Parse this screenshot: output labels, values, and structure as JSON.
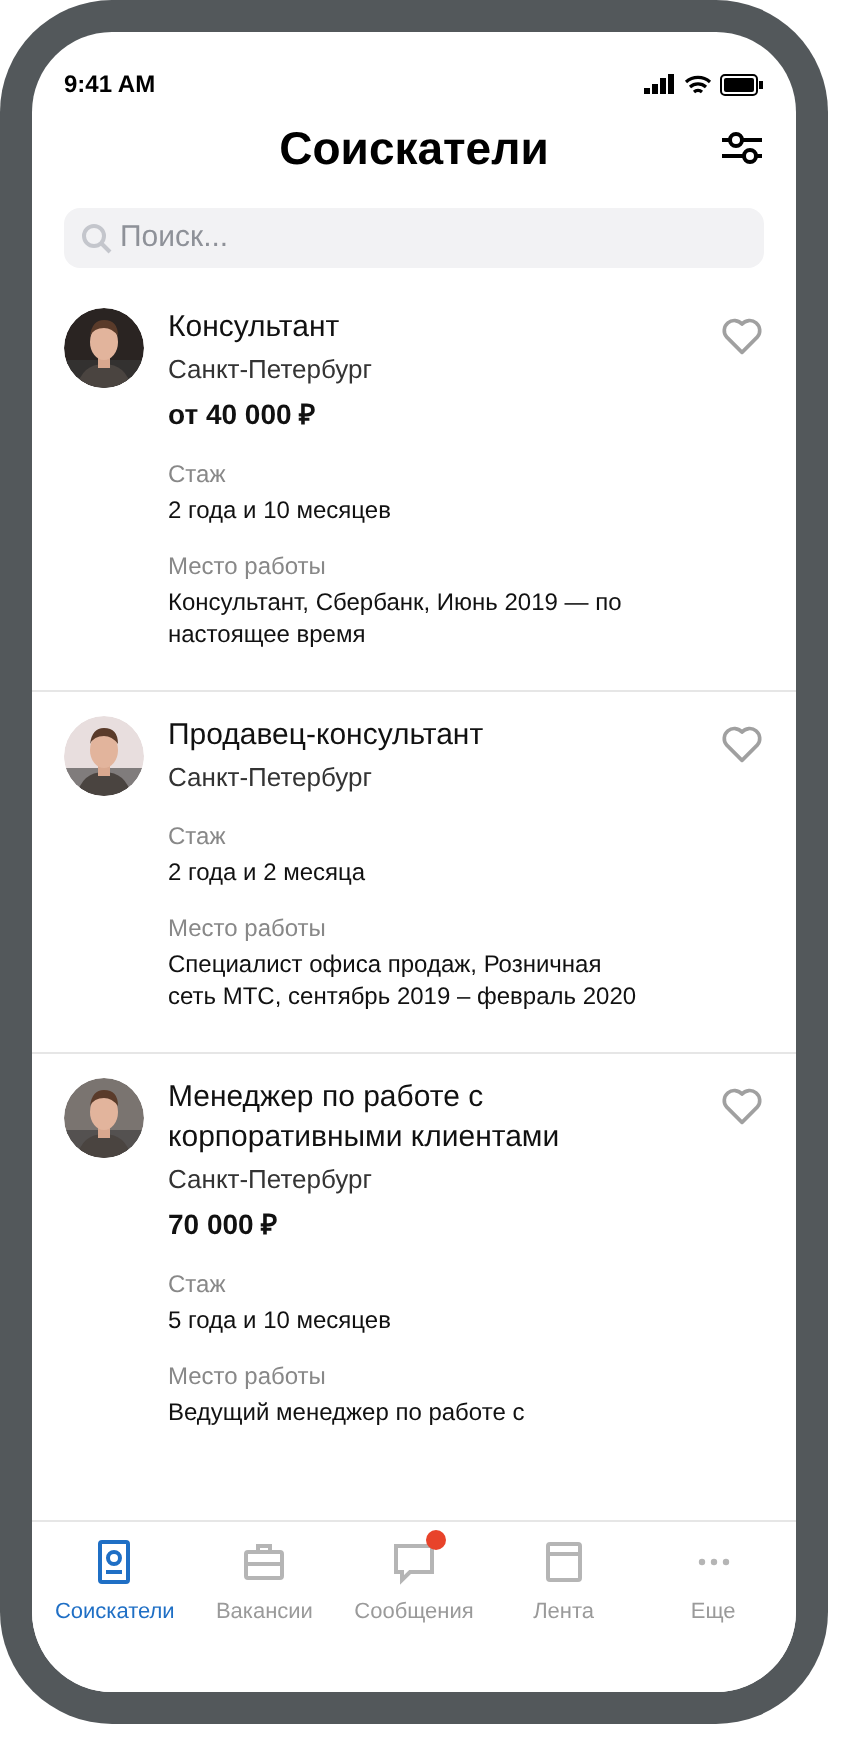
{
  "status_bar": {
    "time": "9:41 AM"
  },
  "header": {
    "title": "Соискатели"
  },
  "search": {
    "placeholder": "Поиск..."
  },
  "candidates": [
    {
      "title": "Консультант",
      "city": "Санкт-Петербург",
      "salary": "от 40 000 ₽",
      "experience_label": "Стаж",
      "experience": "2 года и 10 месяцев",
      "workplace_label": "Место работы",
      "workplace": "Консультант, Сбербанк, Июнь 2019 — по настоящее время",
      "favorite": false
    },
    {
      "title": "Продавец-консультант",
      "city": "Санкт-Петербург",
      "experience_label": "Стаж",
      "experience": "2 года и 2 месяца",
      "workplace_label": "Место работы",
      "workplace": "Специалист офиса продаж, Розничная сеть МТС, сентябрь 2019 – февраль 2020",
      "favorite": false
    },
    {
      "title": "Менеджер по работе с корпоративными клиентами",
      "city": "Санкт-Петербург",
      "salary": "70 000 ₽",
      "experience_label": "Стаж",
      "experience": "5 года и 10 месяцев",
      "workplace_label": "Место работы",
      "workplace": "Ведущий менеджер по работе с",
      "favorite": false
    }
  ],
  "tab_bar": [
    {
      "label": "Соискатели",
      "selected": true,
      "badge": false
    },
    {
      "label": "Вакансии",
      "selected": false,
      "badge": false
    },
    {
      "label": "Сообщения",
      "selected": false,
      "badge": true
    },
    {
      "label": "Лента",
      "selected": false,
      "badge": false
    },
    {
      "label": "Еще",
      "selected": false,
      "badge": false
    }
  ]
}
